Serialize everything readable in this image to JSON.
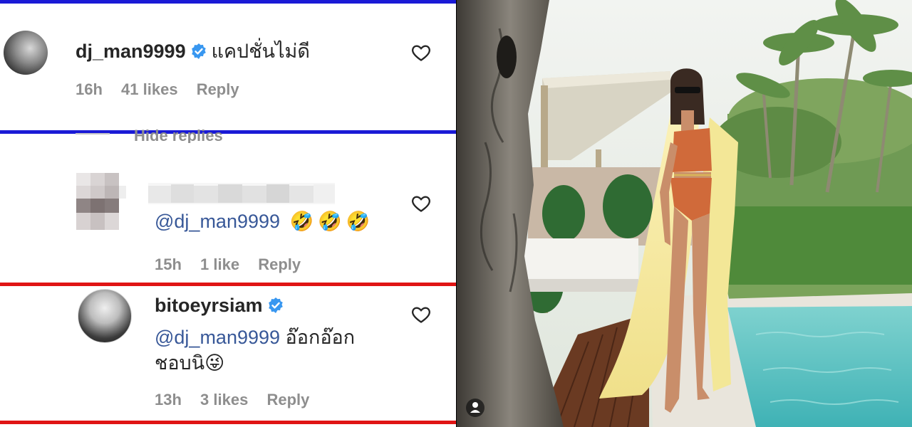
{
  "comments": [
    {
      "username": "dj_man9999",
      "verified": true,
      "text": "แคปชั่นไม่ดี",
      "time": "16h",
      "likes": "41 likes",
      "reply": "Reply"
    },
    {
      "username": "",
      "verified": false,
      "mention": "@dj_man9999",
      "emoji": "🤣🤣🤣",
      "time": "15h",
      "likes": "1 like",
      "reply": "Reply"
    },
    {
      "username": "bitoeyrsiam",
      "verified": true,
      "mention": "@dj_man9999",
      "text": "อ๊อกอ๊อก",
      "text2": "ชอบนิ",
      "emoji": "😜",
      "time": "13h",
      "likes": "3 likes",
      "reply": "Reply"
    }
  ],
  "hide_replies": "Hide replies",
  "colors": {
    "blue_bar": "#1a1ad6",
    "red_bar": "#e01414",
    "verified": "#3897f0",
    "heart": "#262626"
  }
}
